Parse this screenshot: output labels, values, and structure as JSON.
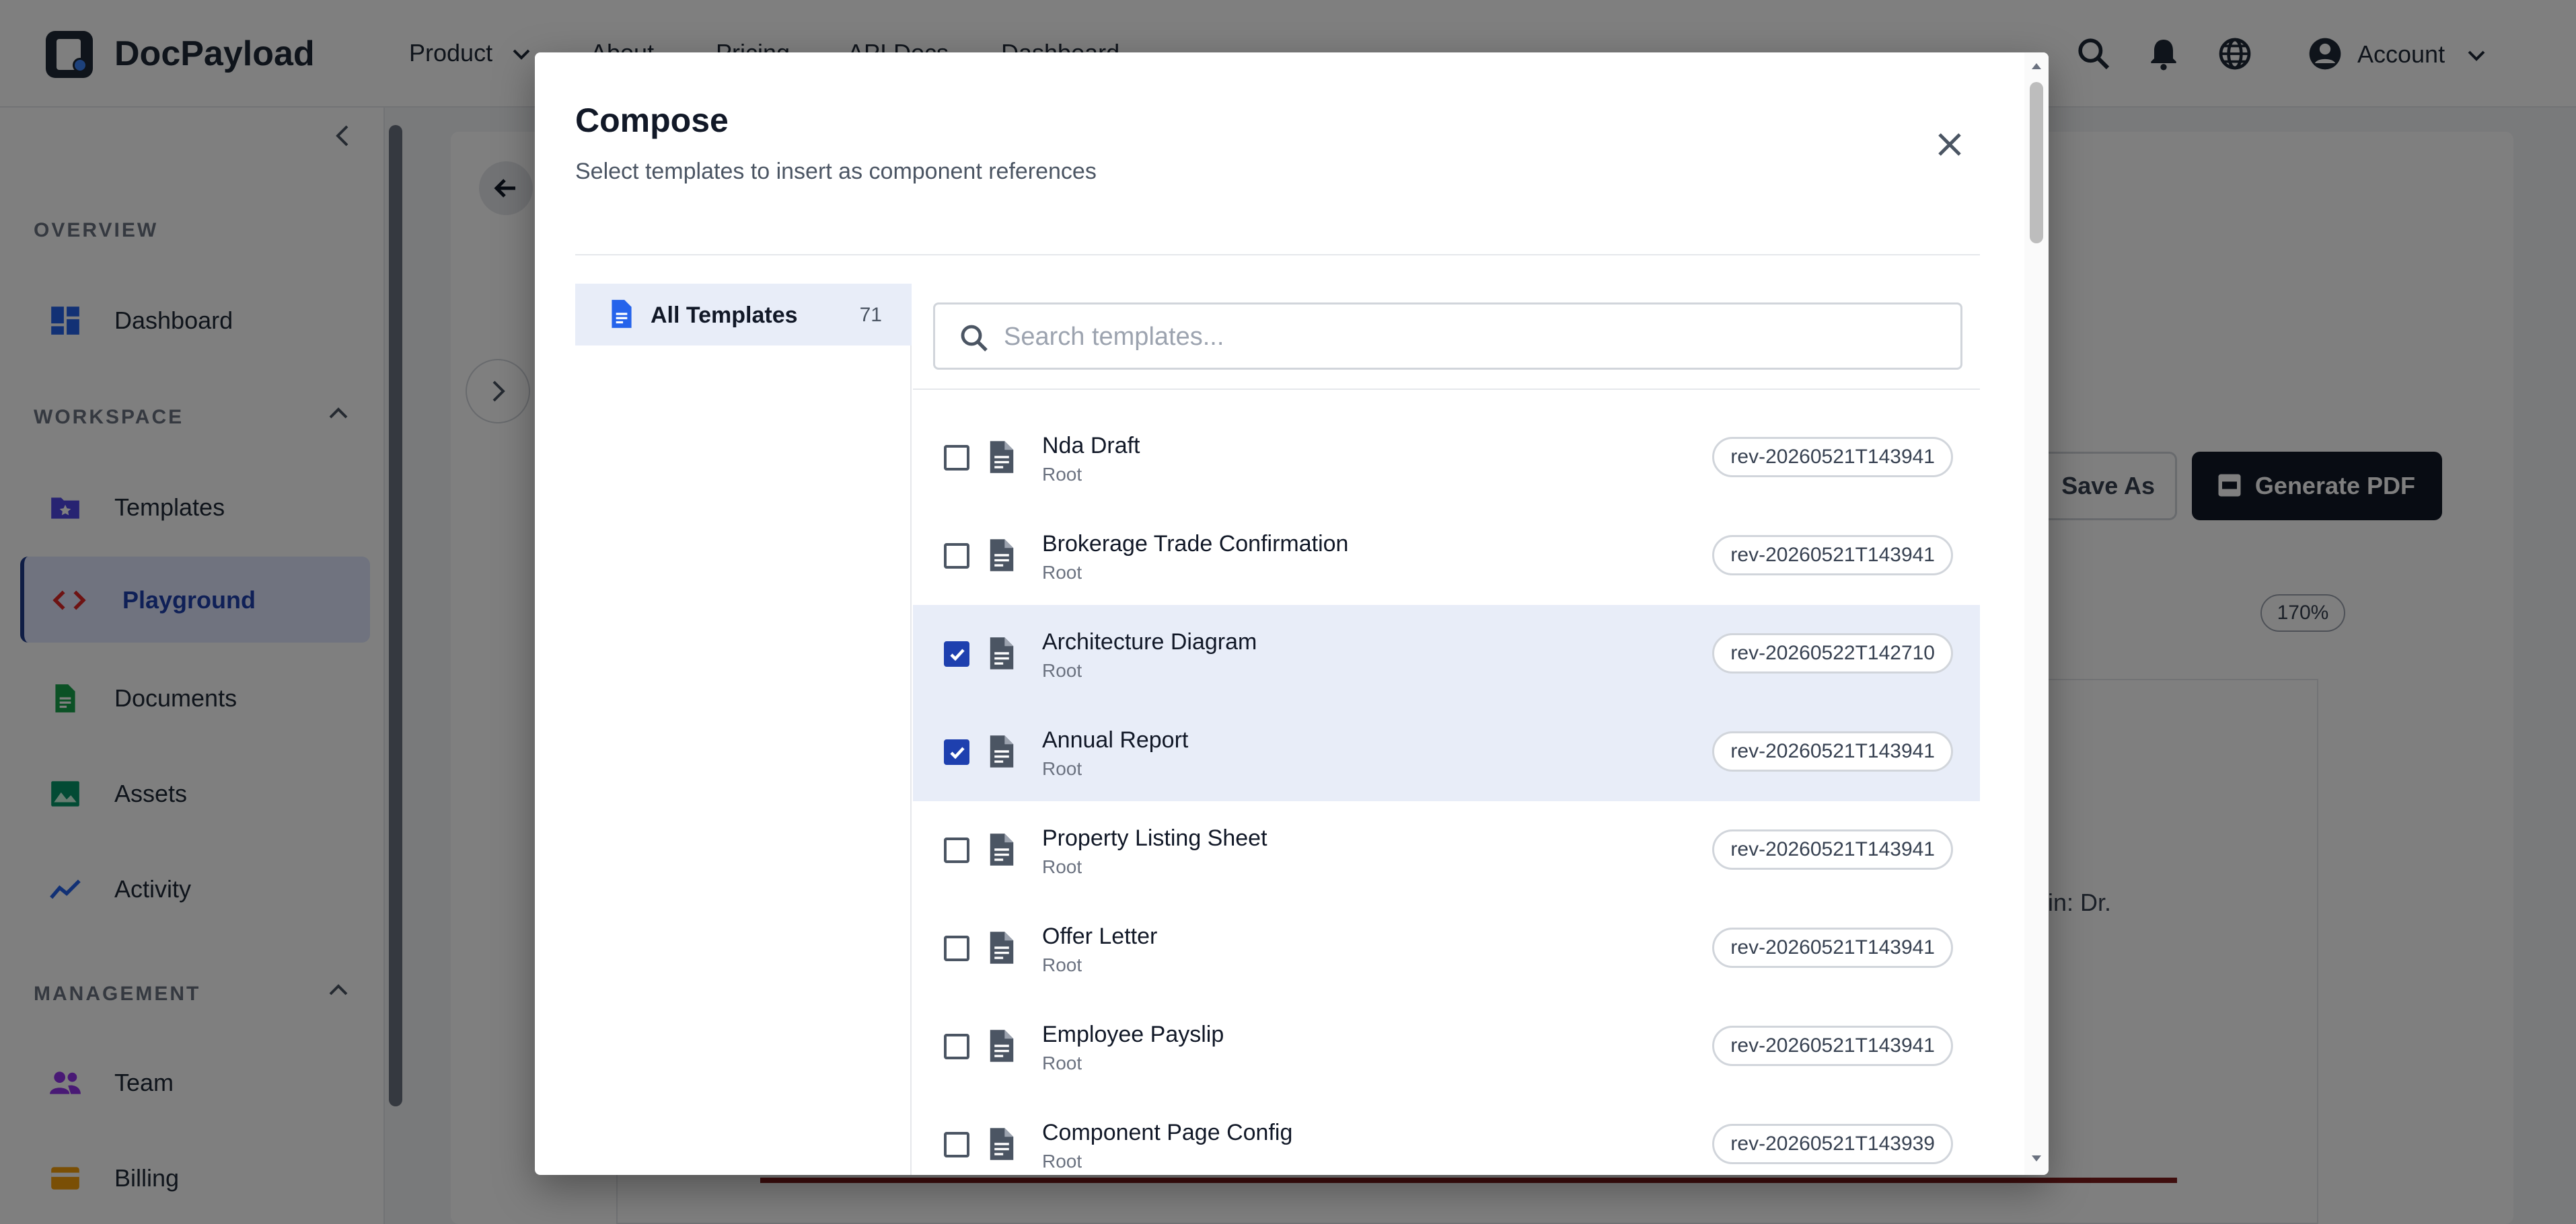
{
  "app": {
    "brand": "DocPayload",
    "nav": [
      {
        "label": "Product"
      },
      {
        "label": "About"
      },
      {
        "label": "Pricing"
      },
      {
        "label": "API Docs"
      },
      {
        "label": "Dashboard"
      }
    ],
    "account_label": "Account"
  },
  "sidebar": {
    "sections": [
      {
        "label": "OVERVIEW"
      },
      {
        "label": "WORKSPACE"
      },
      {
        "label": "MANAGEMENT"
      }
    ],
    "items": [
      {
        "label": "Dashboard",
        "icon": "dashboard-icon",
        "color": "#2563eb"
      },
      {
        "label": "Templates",
        "icon": "templates-folder-icon",
        "color": "#4f46e5"
      },
      {
        "label": "Playground",
        "icon": "code-icon",
        "color": "#dc2626",
        "active": true
      },
      {
        "label": "Documents",
        "icon": "document-icon",
        "color": "#16a34a"
      },
      {
        "label": "Assets",
        "icon": "image-icon",
        "color": "#059669"
      },
      {
        "label": "Activity",
        "icon": "activity-icon",
        "color": "#2563eb"
      },
      {
        "label": "Team",
        "icon": "team-icon",
        "color": "#9333ea"
      },
      {
        "label": "Billing",
        "icon": "billing-icon",
        "color": "#f59e0b"
      }
    ]
  },
  "background": {
    "save_as_label": "Save As",
    "generate_pdf_label": "Generate PDF",
    "zoom": "170%",
    "doc_text_fragment": "rerin: Dr."
  },
  "dialog": {
    "title": "Compose",
    "subtitle": "Select templates to insert as component references",
    "categories": [
      {
        "label": "All Templates",
        "count": "71",
        "active": true
      }
    ],
    "search_placeholder": "Search templates...",
    "search_value": "",
    "templates": [
      {
        "name": "Nda Draft",
        "folder": "Root",
        "revision": "rev-20260521T143941",
        "checked": false
      },
      {
        "name": "Brokerage Trade Confirmation",
        "folder": "Root",
        "revision": "rev-20260521T143941",
        "checked": false
      },
      {
        "name": "Architecture Diagram",
        "folder": "Root",
        "revision": "rev-20260522T142710",
        "checked": true
      },
      {
        "name": "Annual Report",
        "folder": "Root",
        "revision": "rev-20260521T143941",
        "checked": true
      },
      {
        "name": "Property Listing Sheet",
        "folder": "Root",
        "revision": "rev-20260521T143941",
        "checked": false
      },
      {
        "name": "Offer Letter",
        "folder": "Root",
        "revision": "rev-20260521T143941",
        "checked": false
      },
      {
        "name": "Employee Payslip",
        "folder": "Root",
        "revision": "rev-20260521T143941",
        "checked": false
      },
      {
        "name": "Component Page Config",
        "folder": "Root",
        "revision": "rev-20260521T143939",
        "checked": false
      }
    ]
  },
  "colors": {
    "accent": "#1e40af",
    "selected_row": "#e8edf8",
    "brand_dark": "#1f2937"
  }
}
